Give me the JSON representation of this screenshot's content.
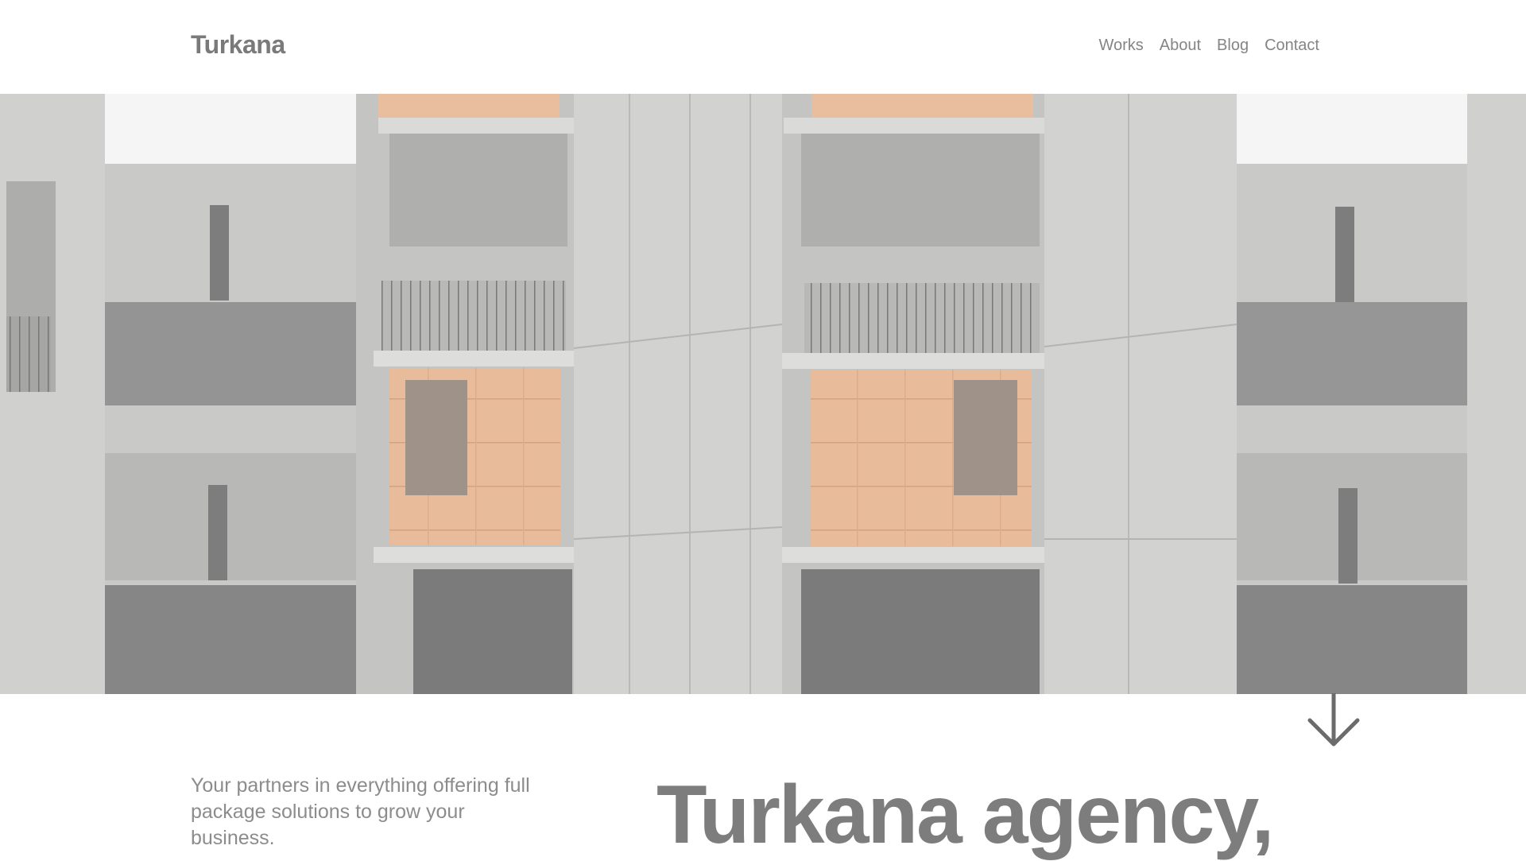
{
  "header": {
    "logo": "Turkana",
    "nav": [
      "Works",
      "About",
      "Blog",
      "Contact"
    ]
  },
  "hero": {
    "image_icon": "building-photo",
    "scroll_icon": "arrow-down-icon"
  },
  "intro": {
    "tagline": "Your partners in everything offering full package solutions to grow your business.",
    "headline": "Turkana agency,"
  },
  "colors": {
    "text": "#808080",
    "concrete": "#c8c8c6",
    "wood": "#e3ad84",
    "shadow": "#6e6e6e"
  }
}
